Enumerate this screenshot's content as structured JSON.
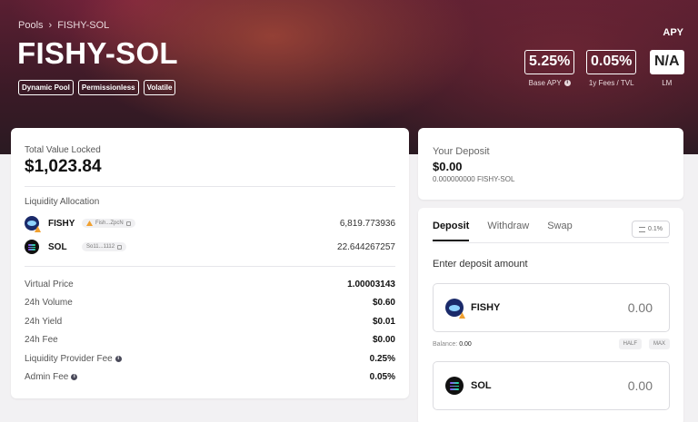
{
  "breadcrumb": {
    "root": "Pools",
    "current": "FISHY-SOL"
  },
  "pool": {
    "title": "FISHY-SOL",
    "tags": [
      "Dynamic Pool",
      "Permissionless",
      "Volatile"
    ]
  },
  "apy": {
    "heading": "APY",
    "stats": [
      {
        "value": "5.25%",
        "label": "Base APY",
        "info": true
      },
      {
        "value": "0.05%",
        "label": "1y Fees / TVL",
        "info": false
      },
      {
        "value": "N/A",
        "label": "LM",
        "info": false
      }
    ]
  },
  "overview": {
    "tvl_label": "Total Value Locked",
    "tvl_value": "$1,023.84",
    "liquidity_label": "Liquidity Allocation",
    "tokens": [
      {
        "symbol": "FISHY",
        "address": "Fish...ZpcN",
        "amount": "6,819.773936",
        "icon": "fishy-token-icon",
        "warning": true
      },
      {
        "symbol": "SOL",
        "address": "So11...1112",
        "amount": "22.644267257",
        "icon": "sol-token-icon",
        "warning": false
      }
    ],
    "metrics": [
      {
        "label": "Virtual Price",
        "value": "1.00003143",
        "info": false
      },
      {
        "label": "24h Volume",
        "value": "$0.60",
        "info": false
      },
      {
        "label": "24h Yield",
        "value": "$0.01",
        "info": false
      },
      {
        "label": "24h Fee",
        "value": "$0.00",
        "info": false
      },
      {
        "label": "Liquidity Provider Fee",
        "value": "0.25%",
        "info": true
      },
      {
        "label": "Admin Fee",
        "value": "0.05%",
        "info": true
      }
    ]
  },
  "your_deposit": {
    "label": "Your Deposit",
    "value": "$0.00",
    "lp_amount": "0.000000000 FISHY-SOL"
  },
  "panel": {
    "tabs": [
      "Deposit",
      "Withdraw",
      "Swap"
    ],
    "active_tab": "Deposit",
    "slippage": "0.1%",
    "enter_label": "Enter deposit amount",
    "inputs": [
      {
        "symbol": "FISHY",
        "placeholder": "0.00"
      },
      {
        "symbol": "SOL",
        "placeholder": "0.00"
      }
    ],
    "balance_label": "Balance:",
    "balance_value": "0.00",
    "half_label": "HALF",
    "max_label": "MAX"
  }
}
